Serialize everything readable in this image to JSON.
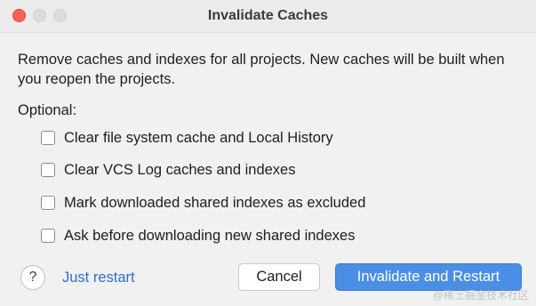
{
  "window": {
    "title": "Invalidate Caches"
  },
  "message": "Remove caches and indexes for all projects. New caches will be built when you reopen the projects.",
  "optional_label": "Optional:",
  "options": [
    {
      "label": "Clear file system cache and Local History",
      "checked": false
    },
    {
      "label": "Clear VCS Log caches and indexes",
      "checked": false
    },
    {
      "label": "Mark downloaded shared indexes as excluded",
      "checked": false
    },
    {
      "label": "Ask before downloading new shared indexes",
      "checked": false
    }
  ],
  "footer": {
    "help_label": "?",
    "just_restart_label": "Just restart",
    "cancel_label": "Cancel",
    "primary_label": "Invalidate and Restart"
  },
  "watermark": "@稀土掘金技术社区",
  "colors": {
    "close_button": "#fe5f57",
    "primary_button": "#4a8ee6",
    "link": "#2f6fc9",
    "window_bg": "#f1f1f1"
  }
}
